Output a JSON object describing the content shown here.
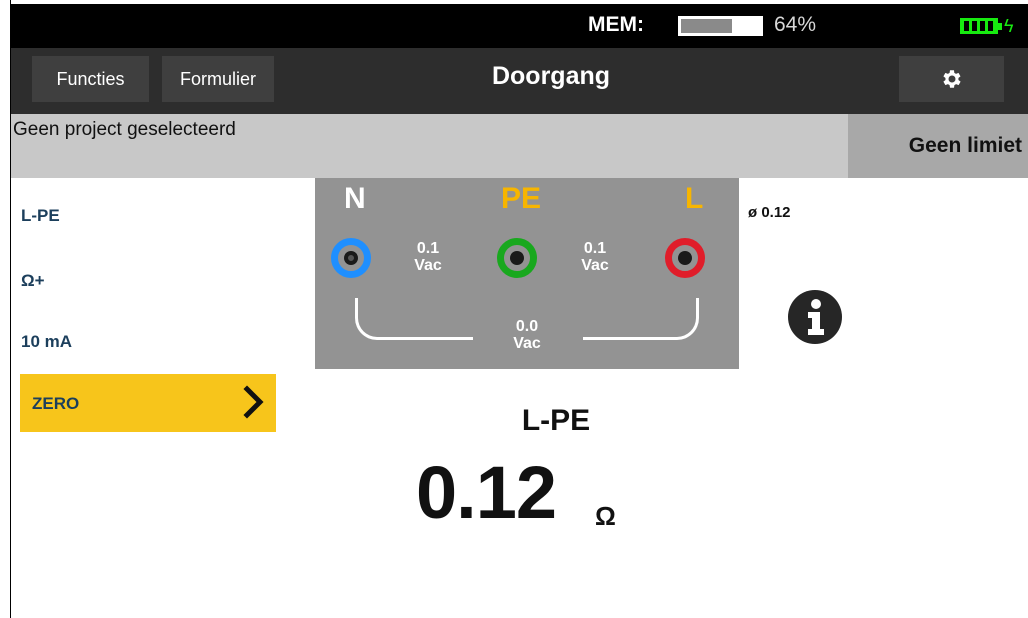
{
  "status": {
    "mem_label": "MEM:",
    "mem_percent_text": "64%",
    "mem_fill_fraction": 0.64,
    "battery_icon": "battery-charging-icon",
    "battery_color": "#17ea10"
  },
  "navbar": {
    "functions_label": "Functies",
    "form_label": "Formulier",
    "title": "Doorgang",
    "settings_icon": "gear-icon"
  },
  "project": {
    "text": "Geen project geselecteerd",
    "limit_label": "Geen limiet"
  },
  "menu": {
    "items": [
      {
        "label": "L-PE"
      },
      {
        "label": "Ω+"
      },
      {
        "label": "10 mA"
      }
    ],
    "zero_label": "ZERO",
    "zero_color": "#f7c51b"
  },
  "probes": {
    "n_label": "N",
    "pe_label": "PE",
    "l_label": "L",
    "n_color": "#1f8fff",
    "pe_color": "#19a81e",
    "l_color": "#e01d2a",
    "accent_color": "#f7b500",
    "n_pe_value": "0.1",
    "n_pe_unit": "Vac",
    "pe_l_value": "0.1",
    "pe_l_unit": "Vac",
    "n_l_value": "0.0",
    "n_l_unit": "Vac"
  },
  "side_reading": "ø 0.12",
  "info_icon": "info-icon",
  "result": {
    "mode": "L-PE",
    "value": "0.12",
    "unit": "Ω"
  }
}
